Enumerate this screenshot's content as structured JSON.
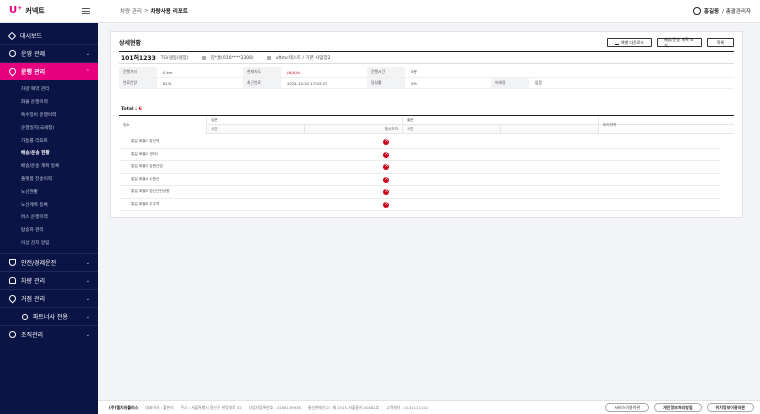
{
  "app": {
    "logo_text": "커넥트",
    "logo_mark": "U⁺"
  },
  "sidebar": {
    "top_items": [
      {
        "label": "대시보드"
      },
      {
        "label": "운영 관제"
      }
    ],
    "active_group": {
      "label": "운행 관리"
    },
    "sub_items": [
      "차량 예약 관리",
      "화물 운행이력",
      "특수장비 운행이력",
      "운행일지(국세청)",
      "가동률 리포트",
      "배송/운송 현황",
      "배송/운송 계획 등록",
      "플랫폼 전송이력",
      "노선현황",
      "노선계획 등록",
      "버스 운행이력",
      "탑승자 관리",
      "이상 감지 알림"
    ],
    "bottom_items": [
      {
        "label": "안전/경제운전"
      },
      {
        "label": "차량 관리"
      },
      {
        "label": "거점 관리"
      },
      {
        "label": "파트너사 전용"
      },
      {
        "label": "조직관리"
      }
    ]
  },
  "header": {
    "breadcrumb": [
      "차량 관리",
      "차량사용 리포트"
    ],
    "separator": ">",
    "user_name": "홍길동",
    "user_role": "/ 총괄관리자"
  },
  "panel": {
    "title": "상세현황",
    "buttons": {
      "download": "엑셀 다운로드",
      "plan": "배송/운송 계획 보기",
      "list": "목록"
    },
    "vehicle": {
      "number": "101허1233",
      "type": "TG(냉동/냉장)",
      "driver": "김*홍(010****3308)",
      "route": "uftmc테스트 / 기본 사업장2"
    },
    "info_rows": [
      [
        {
          "label": "운행거리",
          "value": "0 km"
        },
        {
          "label": "현재속도",
          "value": "(N/A)%",
          "red": true
        },
        {
          "label": "운행시간",
          "value": "0분"
        }
      ],
      [
        {
          "label": "연료잔량",
          "value": "81%"
        },
        {
          "label": "최근연료",
          "value": "2024-10-20 17:53:37"
        },
        {
          "label": "달성률",
          "value": "0%"
        },
        {
          "label": "미배정",
          "value": "없음"
        }
      ]
    ],
    "total_label": "Total :",
    "total_count": "6",
    "table": {
      "col_place": "장소",
      "col_in": "입문",
      "col_out": "출문",
      "col_rest": "비지하역",
      "sub_time": "시간",
      "sub_status": "정시도착",
      "sub_time2": "시간"
    },
    "rows": [
      "통일 화물1 방산역",
      "통일 화물2 센터2",
      "통일 화물3 강원산업",
      "통일 화물4 수원산",
      "통일 화물5 범산근린공원",
      "통일 화물6 우주역"
    ]
  },
  "footer": {
    "company": "(주)엘지유플러스",
    "info1": "대표이사 : 황현식",
    "info2": "주소 : 서울특별시 용산구 한강대로 32",
    "info3": "사업자등록번호 : 2208139938",
    "info4": "통신판매신고 : 제 2015-서울용산-00481호",
    "info5": "고객센터 : 1141111122",
    "links": [
      "서비스이용약관",
      "개인정보처리방침",
      "위치정보이용약관"
    ]
  },
  "colors": {
    "sidebar_bg": "#0b1545",
    "accent": "#e6007e",
    "alert": "#d0021b"
  }
}
